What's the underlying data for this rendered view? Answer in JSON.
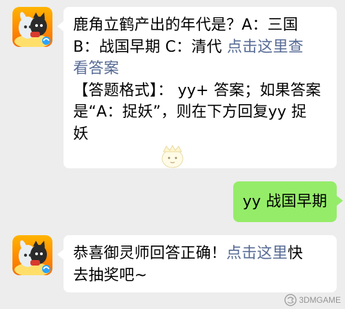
{
  "messages": [
    {
      "from": "bot",
      "avatar": "game-character-avatar",
      "lines": [
        {
          "text": "鹿角立鹤产出的年代是？A：三国",
          "link": ""
        },
        {
          "text": "B：战国早期 C：清代 ",
          "link": "点击这里查"
        },
        {
          "text": "",
          "link": "看答案"
        },
        {
          "text": "【答题格式】： yy+ 答案；如果答案",
          "link": ""
        },
        {
          "text": "是“A：捉妖”，则在下方回复yy 捉",
          "link": ""
        },
        {
          "text": "妖",
          "link": ""
        }
      ]
    },
    {
      "from": "me",
      "text": "yy 战国早期"
    },
    {
      "from": "bot",
      "avatar": "game-character-avatar",
      "lines": [
        {
          "text": "恭喜御灵师回答正确！",
          "link": "点击这里",
          "after": "快"
        },
        {
          "text": "去抽奖吧~",
          "link": ""
        }
      ]
    }
  ],
  "watermark": {
    "text": "3DMGAME"
  },
  "colors": {
    "background": "#ededed",
    "bubble_in": "#ffffff",
    "bubble_out": "#95ec69",
    "link": "#576b95"
  }
}
